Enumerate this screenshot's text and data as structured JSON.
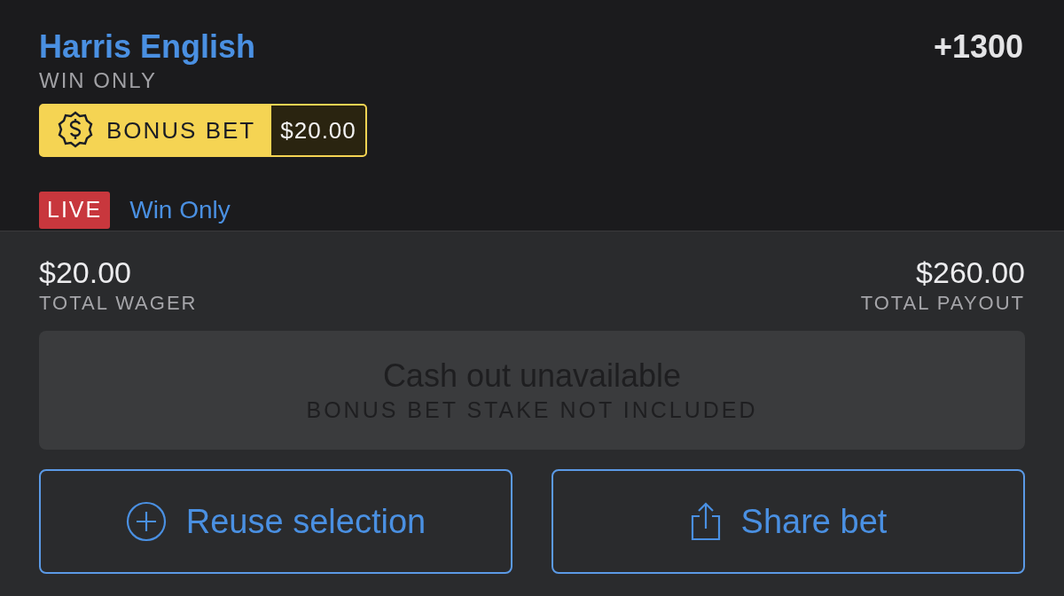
{
  "selection": {
    "name": "Harris English",
    "odds": "+1300",
    "market": "WIN ONLY"
  },
  "bonus_badge": {
    "label": "BONUS BET",
    "amount": "$20.00"
  },
  "live_badge": "LIVE",
  "bet_type": "Win Only",
  "totals": {
    "wager": {
      "amount": "$20.00",
      "label": "TOTAL WAGER"
    },
    "payout": {
      "amount": "$260.00",
      "label": "TOTAL PAYOUT"
    }
  },
  "cash_out": {
    "title": "Cash out unavailable",
    "note": "BONUS BET STAKE NOT INCLUDED",
    "disabled": true
  },
  "actions": [
    {
      "kind": "reuse",
      "label": "Reuse selection"
    },
    {
      "kind": "share",
      "label": "Share bet"
    }
  ]
}
